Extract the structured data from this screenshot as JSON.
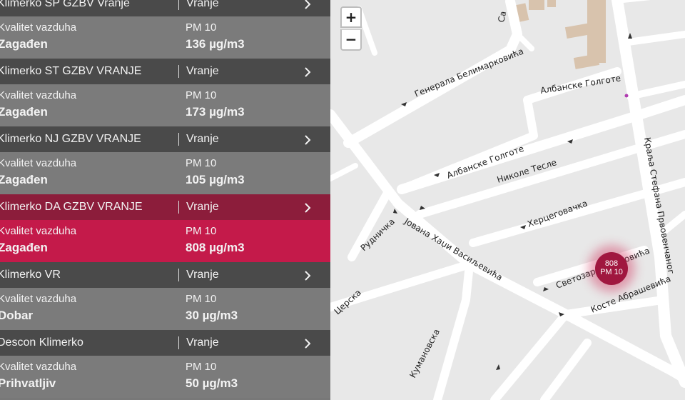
{
  "stations": [
    {
      "name": "Klimerko SP GZBV Vranje",
      "city": "Vranje",
      "quality_label": "Kvalitet vazduha",
      "quality_value": "Zagađen",
      "pollutant": "PM 10",
      "value": "136 µg/m3",
      "active": false
    },
    {
      "name": "Klimerko ST GZBV VRANJE",
      "city": "Vranje",
      "quality_label": "Kvalitet vazduha",
      "quality_value": "Zagađen",
      "pollutant": "PM 10",
      "value": "173 µg/m3",
      "active": false
    },
    {
      "name": "Klimerko NJ GZBV VRANJE",
      "city": "Vranje",
      "quality_label": "Kvalitet vazduha",
      "quality_value": "Zagađen",
      "pollutant": "PM 10",
      "value": "105 µg/m3",
      "active": false
    },
    {
      "name": "Klimerko DA GZBV VRANJE",
      "city": "Vranje",
      "quality_label": "Kvalitet vazduha",
      "quality_value": "Zagađen",
      "pollutant": "PM 10",
      "value": "808 µg/m3",
      "active": true
    },
    {
      "name": "Klimerko VR",
      "city": "Vranje",
      "quality_label": "Kvalitet vazduha",
      "quality_value": "Dobar",
      "pollutant": "PM 10",
      "value": "30 µg/m3",
      "active": false
    },
    {
      "name": "Descon Klimerko",
      "city": "Vranje",
      "quality_label": "Kvalitet vazduha",
      "quality_value": "Prihvatljiv",
      "pollutant": "PM 10",
      "value": "50 µg/m3",
      "active": false
    }
  ],
  "map": {
    "zoom_in": "+",
    "zoom_out": "−",
    "marker": {
      "value": "808",
      "pollutant": "PM 10"
    },
    "streets": {
      "generala": "Генерала Белимарковића",
      "albanske_top": "Албанске Голготе",
      "albanske_left": "Албанске Голготе",
      "nikole": "Николе Тесле",
      "hercegovacka": "Херцеговачка",
      "rudnicka": "Рудничка",
      "jovana": "Јована Хаџи Васиљевића",
      "kralja": "Краља Стефана Првовенчаног",
      "svetozara": "Светозара Марковића",
      "koste": "Косте Абрашевића",
      "cerska": "Церска",
      "kumanovska": "Кумановска",
      "sa": "Са"
    }
  },
  "colors": {
    "header_bg": "#4a4a4a",
    "row_bg": "#7b7b7b",
    "active_header_bg": "#8c1d3b",
    "active_row_bg": "#c41a4a",
    "marker": "#a0173f"
  }
}
